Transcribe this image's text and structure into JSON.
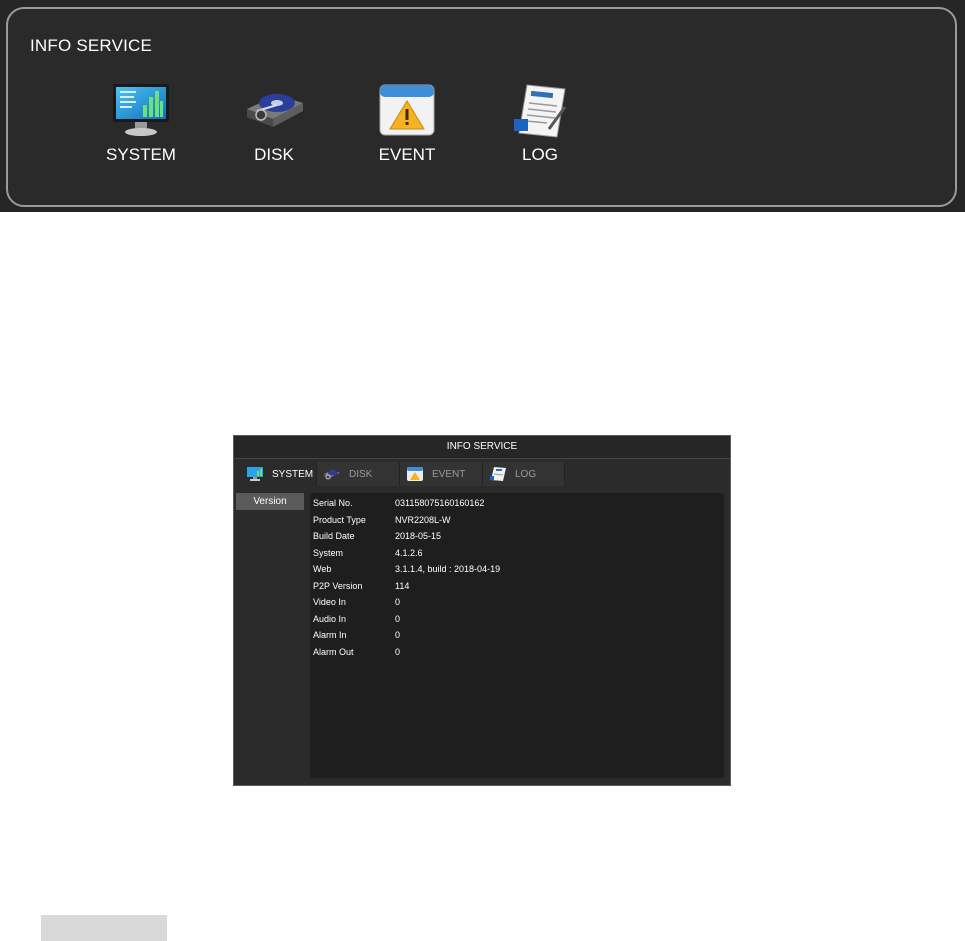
{
  "top_panel": {
    "title": "INFO SERVICE",
    "items": [
      {
        "label": "SYSTEM",
        "icon": "system-monitor-icon"
      },
      {
        "label": "DISK",
        "icon": "disk-icon"
      },
      {
        "label": "EVENT",
        "icon": "event-warning-icon"
      },
      {
        "label": "LOG",
        "icon": "log-document-icon"
      }
    ]
  },
  "window": {
    "title": "INFO SERVICE",
    "tabs": [
      {
        "label": "SYSTEM",
        "active": true,
        "icon": "system-monitor-icon"
      },
      {
        "label": "DISK",
        "active": false,
        "icon": "disk-icon"
      },
      {
        "label": "EVENT",
        "active": false,
        "icon": "event-warning-icon"
      },
      {
        "label": "LOG",
        "active": false,
        "icon": "log-document-icon"
      }
    ],
    "sidebar": {
      "version_label": "Version"
    },
    "info_rows": [
      {
        "key": "Serial No.",
        "value": "031158075160160162"
      },
      {
        "key": "Product Type",
        "value": "NVR2208L-W"
      },
      {
        "key": "Build Date",
        "value": "2018-05-15"
      },
      {
        "key": "System",
        "value": "4.1.2.6"
      },
      {
        "key": "Web",
        "value": "3.1.1.4, build : 2018-04-19"
      },
      {
        "key": "P2P Version",
        "value": "114"
      },
      {
        "key": "Video In",
        "value": "0"
      },
      {
        "key": "Audio In",
        "value": "0"
      },
      {
        "key": "Alarm In",
        "value": "0"
      },
      {
        "key": "Alarm Out",
        "value": "0"
      }
    ]
  },
  "colors": {
    "panel_bg": "#262626",
    "panel_border": "#9a9a9a",
    "content_bg": "#1e1e1e",
    "active_side": "#5a5a5a"
  }
}
